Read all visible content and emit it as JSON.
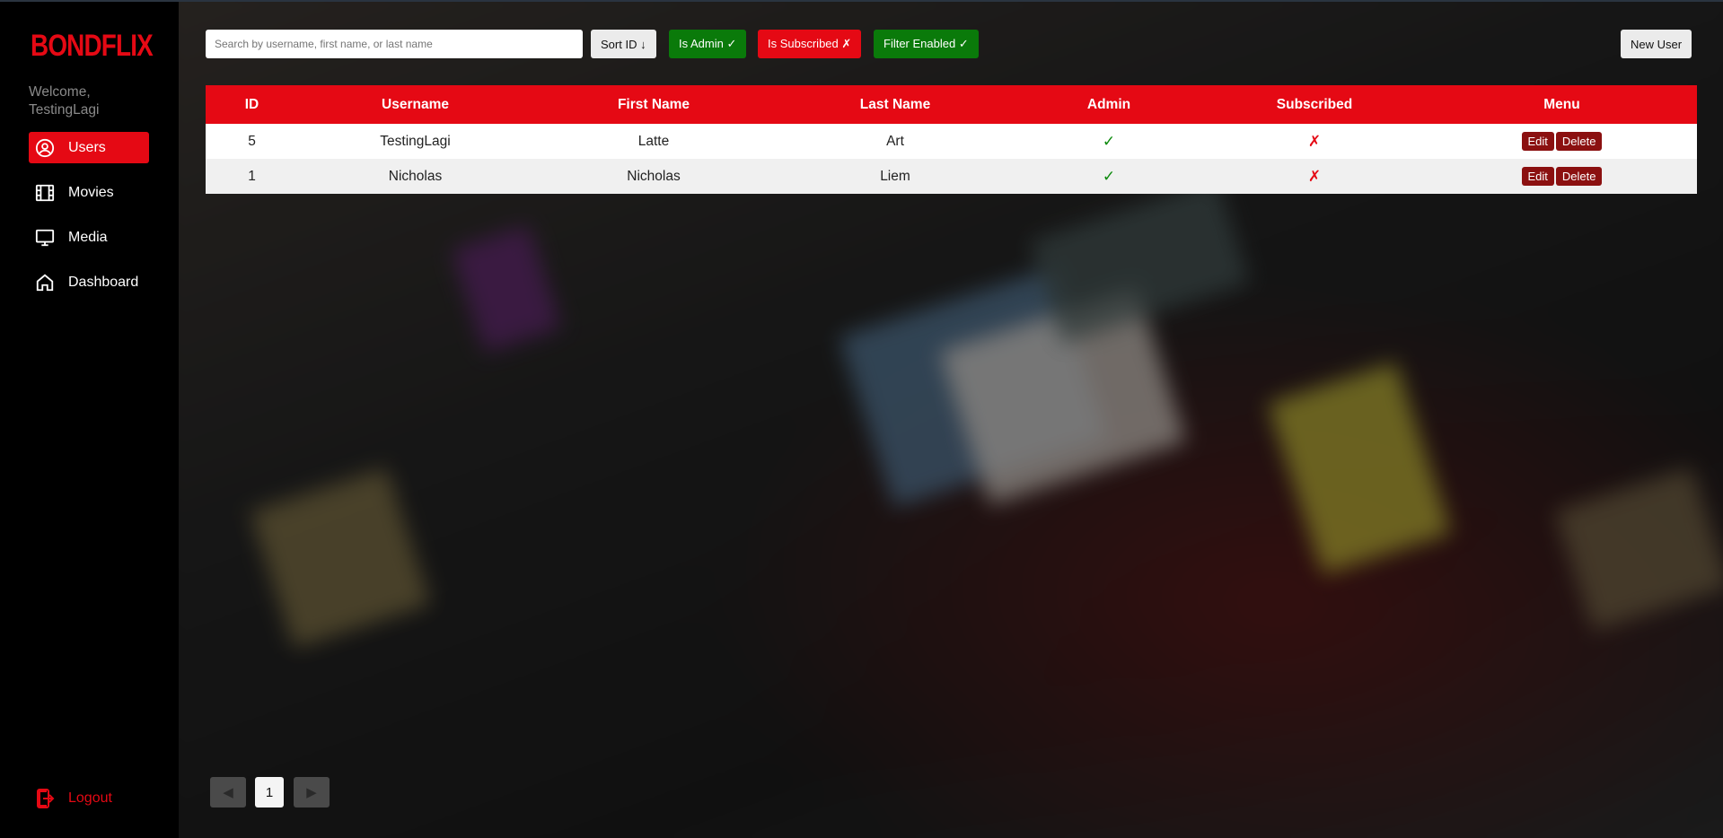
{
  "brand": {
    "name": "BONDFLIX",
    "color": "#e50914"
  },
  "sidebar": {
    "welcome": "Welcome, TestingLagi",
    "items": [
      {
        "label": "Users",
        "icon": "user-circle-icon",
        "active": true
      },
      {
        "label": "Movies",
        "icon": "film-icon",
        "active": false
      },
      {
        "label": "Media",
        "icon": "monitor-icon",
        "active": false
      },
      {
        "label": "Dashboard",
        "icon": "home-icon",
        "active": false
      }
    ],
    "logout": {
      "label": "Logout",
      "icon": "logout-icon"
    }
  },
  "toolbar": {
    "search_placeholder": "Search by username, first name, or last name",
    "search_value": "",
    "sort_label": "Sort ID ↓",
    "admin_filter_label": "Is Admin ✓",
    "subscribed_filter_label": "Is Subscribed ✗",
    "filter_enabled_label": "Filter Enabled ✓",
    "new_user_label": "New User"
  },
  "table": {
    "columns": [
      "ID",
      "Username",
      "First Name",
      "Last Name",
      "Admin",
      "Subscribed",
      "Menu"
    ],
    "rows": [
      {
        "id": "5",
        "username": "TestingLagi",
        "first_name": "Latte",
        "last_name": "Art",
        "admin": "✓",
        "subscribed": "✗",
        "edit": "Edit",
        "delete": "Delete"
      },
      {
        "id": "1",
        "username": "Nicholas",
        "first_name": "Nicholas",
        "last_name": "Liem",
        "admin": "✓",
        "subscribed": "✗",
        "edit": "Edit",
        "delete": "Delete"
      }
    ]
  },
  "pagination": {
    "prev": "◀",
    "current": "1",
    "next": "▶"
  },
  "colors": {
    "accent": "#e50914",
    "success": "#0a7a0a",
    "action": "#8b1010"
  }
}
